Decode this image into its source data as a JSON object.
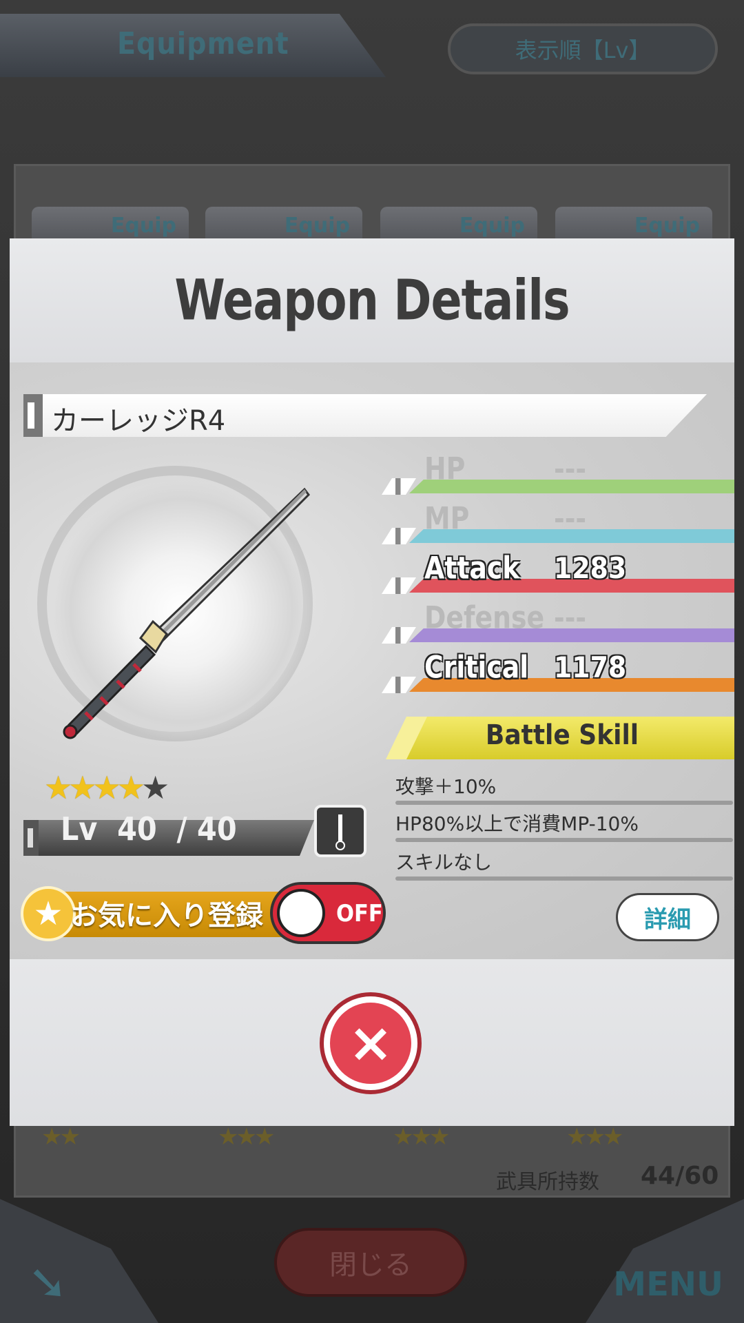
{
  "background": {
    "header_title": "Equipment",
    "sort_label": "表示順【Lv】",
    "card_label": "Equip",
    "holdings_label": "武具所持数",
    "holdings_value": "44/60",
    "close_label": "閉じる",
    "menu_label": "MENU"
  },
  "modal": {
    "title": "Weapon Details",
    "weapon_name": "カーレッジR4",
    "rarity": {
      "filled": 4,
      "total": 5
    },
    "level_text": "Lv  40  / 40",
    "favorite": {
      "label": "お気に入り登録",
      "toggle_label": "OFF"
    },
    "stats": [
      {
        "label": "HP",
        "value": "---",
        "color": "#9fd07a"
      },
      {
        "label": "MP",
        "value": "---",
        "color": "#7fcad8"
      },
      {
        "label": "Attack",
        "value": "1283",
        "color": "#e0535c"
      },
      {
        "label": "Defense",
        "value": "---",
        "color": "#a58bd6"
      },
      {
        "label": "Critical",
        "value": "1178",
        "color": "#e8892e"
      }
    ],
    "battle_skill": {
      "header": "Battle Skill",
      "lines": [
        "攻撃＋10%",
        "HP80%以上で消費MP-10%",
        "スキルなし"
      ]
    },
    "detail_button": "詳細",
    "close_icon": "×"
  },
  "colors": {
    "accent_gold": "#e5a51c",
    "toggle_red": "#d9293b",
    "close_red": "#e34453",
    "skill_yellow": "#e3d84a"
  }
}
